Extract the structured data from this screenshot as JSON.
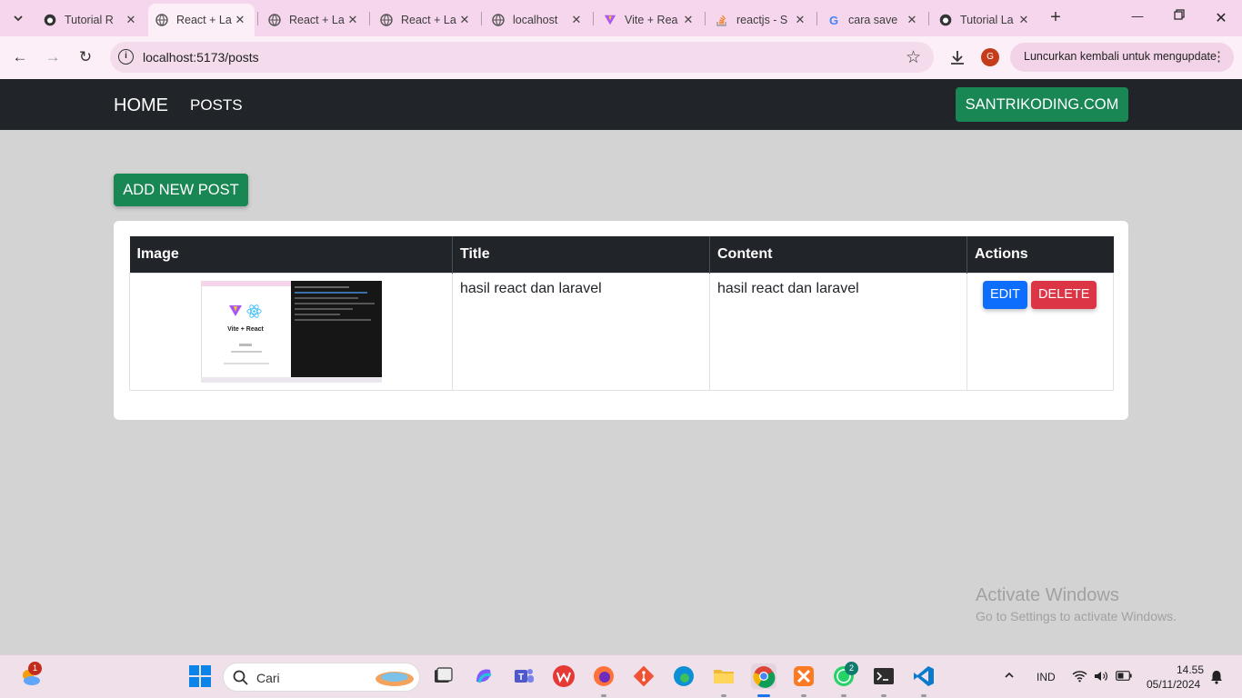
{
  "browser": {
    "tabs": [
      {
        "label": "Tutorial R",
        "icon": "github-icon",
        "active": false
      },
      {
        "label": "React + La",
        "icon": "globe-icon",
        "active": true
      },
      {
        "label": "React + La",
        "icon": "globe-icon",
        "active": false
      },
      {
        "label": "React + La",
        "icon": "globe-icon",
        "active": false
      },
      {
        "label": "localhost",
        "icon": "globe-icon",
        "active": false
      },
      {
        "label": "Vite + Rea",
        "icon": "vite-icon",
        "active": false
      },
      {
        "label": "reactjs - S",
        "icon": "stackoverflow-icon",
        "active": false
      },
      {
        "label": "cara save",
        "icon": "google-icon",
        "active": false
      },
      {
        "label": "Tutorial La",
        "icon": "github-icon",
        "active": false
      }
    ],
    "url": "localhost:5173/posts",
    "profile_initial": "G",
    "relaunch_label": "Luncurkan kembali untuk mengupdate"
  },
  "navbar": {
    "brand": "HOME",
    "posts_link": "POSTS",
    "site_button": "SANTRIKODING.COM"
  },
  "page": {
    "add_button": "ADD NEW POST",
    "table": {
      "headers": [
        "Image",
        "Title",
        "Content",
        "Actions"
      ],
      "rows": [
        {
          "image_caption": "Vite + React",
          "title": "hasil react dan laravel",
          "content": "hasil react dan laravel",
          "edit_label": "EDIT",
          "delete_label": "DELETE"
        }
      ]
    }
  },
  "watermark": {
    "line1": "Activate Windows",
    "line2": "Go to Settings to activate Windows."
  },
  "taskbar": {
    "weather_badge": "1",
    "search_placeholder": "Cari",
    "whatsapp_badge": "2",
    "language": "IND",
    "time": "14.55",
    "date": "05/11/2024"
  },
  "colors": {
    "success": "#198754",
    "primary": "#0d6efd",
    "danger": "#dc3545",
    "dark": "#212529",
    "page_bg": "#d3d3d3"
  }
}
